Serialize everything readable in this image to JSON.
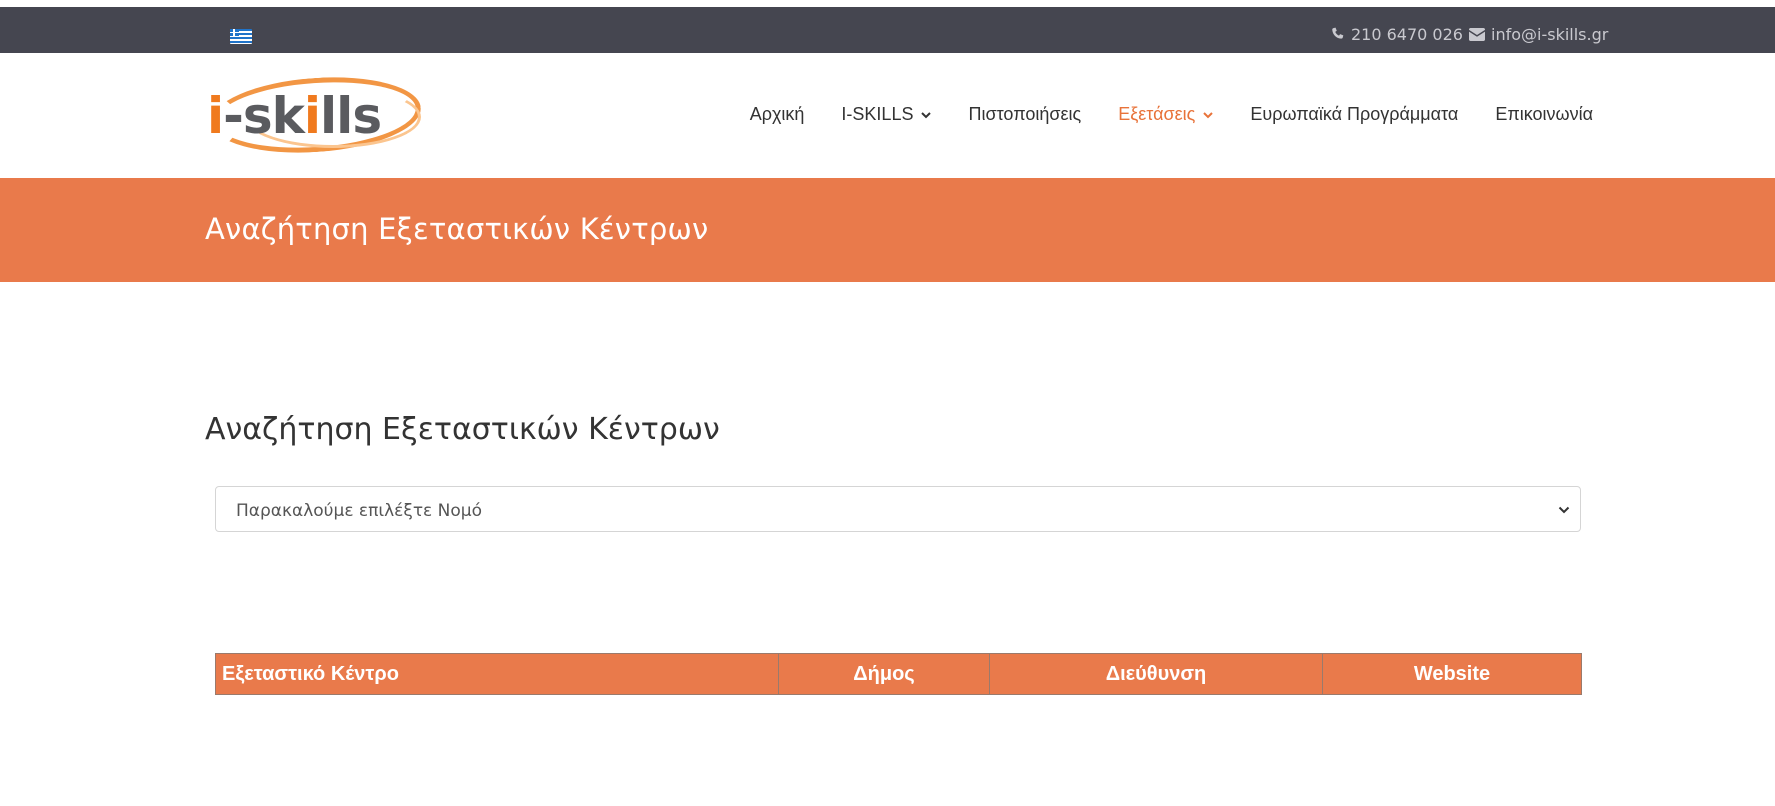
{
  "topbar": {
    "language_flag": "greek-flag-icon",
    "phone": "210 6470 026",
    "email": "info@i-skills.gr"
  },
  "logo": {
    "text_prefix": "i-sk",
    "text_accent": "i",
    "text_suffix": "lls"
  },
  "nav": {
    "items": [
      {
        "label": "Αρχική",
        "dropdown": false,
        "active": false
      },
      {
        "label": "I-SKILLS",
        "dropdown": true,
        "active": false
      },
      {
        "label": "Πιστοποιήσεις",
        "dropdown": false,
        "active": false
      },
      {
        "label": "Εξετάσεις",
        "dropdown": true,
        "active": true
      },
      {
        "label": "Ευρωπαϊκά Προγράμματα",
        "dropdown": false,
        "active": false
      },
      {
        "label": "Επικοινωνία",
        "dropdown": false,
        "active": false
      }
    ]
  },
  "banner": {
    "title": "Αναζήτηση Εξεταστικών Κέντρων"
  },
  "main": {
    "section_title": "Αναζήτηση Εξεταστικών Κέντρων",
    "county_select": {
      "selected": "Παρακαλούμε επιλέξτε Νομό"
    },
    "table": {
      "headers": [
        "Εξεταστικό Κέντρο",
        "Δήμος",
        "Διεύθυνση",
        "Website"
      ],
      "rows": []
    }
  },
  "colors": {
    "accent": "#e97a4b",
    "topbar": "#454650",
    "active_nav": "#e8733a"
  }
}
